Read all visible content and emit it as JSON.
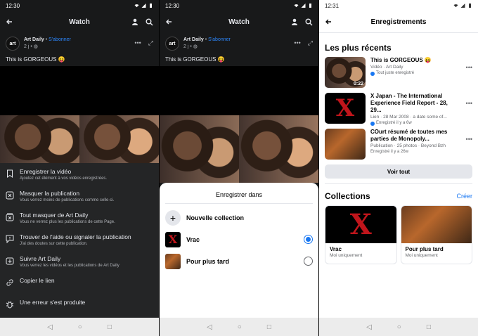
{
  "left": {
    "status": {
      "time": "12:30"
    },
    "appbar": {
      "title": "Watch"
    },
    "post": {
      "avatar_text": "art",
      "author": "Art Daily",
      "separator": "•",
      "follow": "S'abonner",
      "meta": "2 j • ",
      "caption": "This is GORGEOUS 😝"
    },
    "menu": [
      {
        "icon": "bookmark-icon",
        "title": "Enregistrer la vidéo",
        "desc": "Ajoutez cet élément à vos vidéos enregistrées."
      },
      {
        "icon": "hide-icon",
        "title": "Masquer la publication",
        "desc": "Vous verrez moins de publications comme celle-ci."
      },
      {
        "icon": "hide-all-icon",
        "title": "Tout masquer de Art Daily",
        "desc": "Vous ne verrez plus les publications de cette Page."
      },
      {
        "icon": "report-icon",
        "title": "Trouver de l'aide ou signaler la publication",
        "desc": "J'ai des doutes sur cette publication."
      },
      {
        "icon": "follow-icon",
        "title": "Suivre Art Daily",
        "desc": "Vous verrez les vidéos et les publications de Art Daily"
      },
      {
        "icon": "link-icon",
        "title": "Copier le lien",
        "desc": ""
      },
      {
        "icon": "bug-icon",
        "title": "Une erreur s'est produite",
        "desc": ""
      }
    ]
  },
  "middle": {
    "status": {
      "time": "12:30"
    },
    "appbar": {
      "title": "Watch"
    },
    "post": {
      "avatar_text": "art",
      "author": "Art Daily",
      "separator": "•",
      "follow": "S'abonner",
      "meta": "2 j • ",
      "caption": "This is GORGEOUS 😝"
    },
    "save_sheet": {
      "title": "Enregistrer dans",
      "new_collection": "Nouvelle collection",
      "options": [
        {
          "label": "Vrac",
          "selected": true
        },
        {
          "label": "Pour plus tard",
          "selected": false
        }
      ]
    }
  },
  "right": {
    "status": {
      "time": "12:31"
    },
    "appbar": {
      "title": "Enregistrements"
    },
    "recent": {
      "heading": "Les plus récents",
      "items": [
        {
          "title": "This is GORGEOUS 😝",
          "meta": "Vidéo · Art Daily",
          "status": "Tout juste enregistré",
          "duration": "0:22"
        },
        {
          "title": "X Japan - The International Experience Field Report - 28, 29...",
          "meta": "Lien · 28 Mar 2008 · a date some of...",
          "status": "Enregistré il y a 6w",
          "duration": ""
        },
        {
          "title": "COurt résumé de toutes mes parties de Monopoly...",
          "meta": "Publication · 25 photos · Beyond Bzh",
          "status": "Enregistré il y a 26w",
          "duration": ""
        }
      ],
      "see_all": "Voir tout"
    },
    "collections": {
      "heading": "Collections",
      "create": "Créer",
      "cards": [
        {
          "name": "Vrac",
          "privacy": "Moi uniquement"
        },
        {
          "name": "Pour plus tard",
          "privacy": "Moi uniquement"
        }
      ]
    }
  },
  "colors": {
    "accent": "#1877f2",
    "dark_bg": "#18191a",
    "sheet_dark": "#242526"
  }
}
